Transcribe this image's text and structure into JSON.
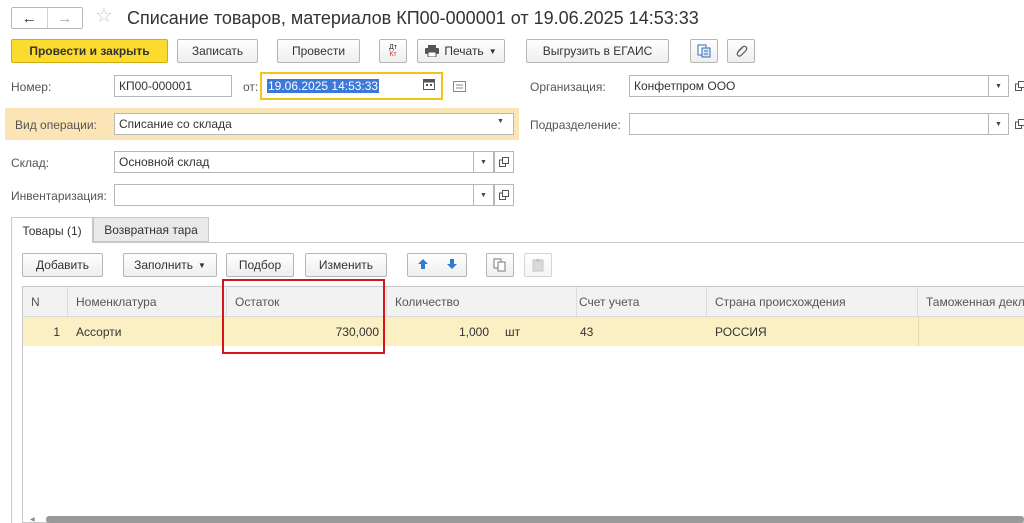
{
  "window": {
    "title": "Списание товаров, материалов КП00-000001 от 19.06.2025 14:53:33",
    "nav_back": "←",
    "nav_forward": "→",
    "favorite_star": "☆"
  },
  "toolbar": {
    "post_and_close": "Провести и закрыть",
    "save": "Записать",
    "post": "Провести",
    "dt_kt_icon_top": "Дт",
    "dt_kt_icon_bottom": "Кт",
    "print": "Печать",
    "unload_egais": "Выгрузить в ЕГАИС"
  },
  "form": {
    "number_label": "Номер:",
    "number_value": "КП00-000001",
    "date_label": "от:",
    "date_value": "19.06.2025 14:53:33",
    "organization_label": "Организация:",
    "organization_value": "Конфетпром ООО",
    "operation_type_label": "Вид операции:",
    "operation_type_value": "Списание со склада",
    "department_label": "Подразделение:",
    "department_value": "",
    "warehouse_label": "Склад:",
    "warehouse_value": "Основной склад",
    "inventory_label": "Инвентаризация:",
    "inventory_value": ""
  },
  "tabs": [
    {
      "label": "Товары (1)",
      "active": true
    },
    {
      "label": "Возвратная тара",
      "active": false
    }
  ],
  "table_toolbar": {
    "add": "Добавить",
    "fill": "Заполнить",
    "selection": "Подбор",
    "change": "Изменить"
  },
  "table": {
    "columns": [
      "N",
      "Номенклатура",
      "Остаток",
      "Количество",
      "",
      "Счет учета",
      "Страна происхождения",
      "Таможенная декл"
    ],
    "rows": [
      {
        "n": "1",
        "item": "Ассорти",
        "balance": "730,000",
        "quantity": "1,000",
        "unit": "шт",
        "account": "43",
        "country": "РОССИЯ",
        "customs": ""
      }
    ]
  },
  "colors": {
    "primary_button": "#fbdb2e",
    "selected_row": "#fbefc4",
    "operation_type_highlight": "#fbe5b7",
    "annotation_box": "#d4161b",
    "date_focus_border": "#f0c419",
    "date_selection": "#3c78d8"
  }
}
